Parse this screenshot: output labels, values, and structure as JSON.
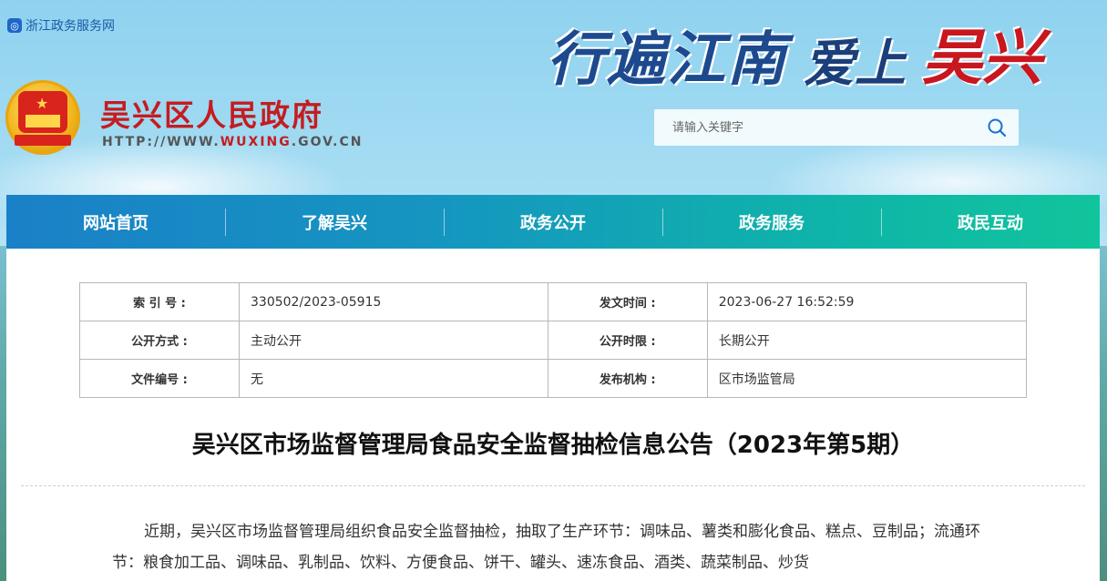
{
  "top_link": {
    "label": "浙江政务服务网",
    "icon": "zhejiang-portal-icon"
  },
  "slogan": {
    "part1": "行遍江南",
    "part2": "爱上",
    "part3": "吴兴"
  },
  "site": {
    "name": "吴兴区人民政府",
    "url_prefix": "HTTP://WWW.",
    "url_highlight": "WUXING",
    "url_suffix": ".GOV.CN",
    "emblem": "national-emblem"
  },
  "search": {
    "placeholder": "请输入关键字",
    "icon": "search-icon"
  },
  "nav": {
    "items": [
      {
        "label": "网站首页"
      },
      {
        "label": "了解吴兴"
      },
      {
        "label": "政务公开"
      },
      {
        "label": "政务服务"
      },
      {
        "label": "政民互动"
      }
    ]
  },
  "meta": {
    "rows": [
      {
        "k1": "索 引 号 :",
        "v1": "330502/2023-05915",
        "k2": "发文时间 :",
        "v2": "2023-06-27 16:52:59"
      },
      {
        "k1": "公开方式 :",
        "v1": "主动公开",
        "k2": "公开时限 :",
        "v2": "长期公开"
      },
      {
        "k1": "文件编号 :",
        "v1": "无",
        "k2": "发布机构 :",
        "v2": "区市场监管局"
      }
    ]
  },
  "article": {
    "title": "吴兴区市场监督管理局食品安全监督抽检信息公告（2023年第5期）",
    "body": "近期，吴兴区市场监督管理局组织食品安全监督抽检，抽取了生产环节：调味品、薯类和膨化食品、糕点、豆制品；流通环节：粮食加工品、调味品、乳制品、饮料、方便食品、饼干、罐头、速冻食品、酒类、蔬菜制品、炒货"
  },
  "colors": {
    "brand_red": "#c51c20",
    "nav_start": "#1a80c7",
    "nav_end": "#10c49c",
    "link_blue": "#1a5aa8"
  }
}
